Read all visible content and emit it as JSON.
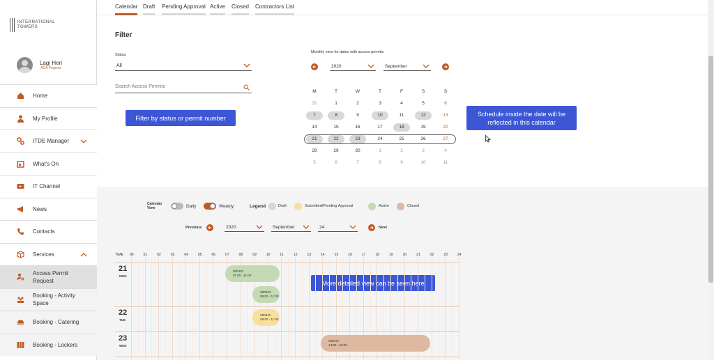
{
  "tabs": [
    {
      "label": "Calendar",
      "active": true
    },
    {
      "label": "Draft",
      "active": false
    },
    {
      "label": "Pending Approval",
      "active": false
    },
    {
      "label": "Active",
      "active": false
    },
    {
      "label": "Closed",
      "active": false
    },
    {
      "label": "Contractors List",
      "active": false
    }
  ],
  "logo": {
    "line1": "INTERNATIONAL",
    "line2": "TOWERS"
  },
  "profile": {
    "name": "Lagi Heri",
    "role": "ACA Projects"
  },
  "menu": [
    {
      "label": "Home",
      "icon": "home-icon"
    },
    {
      "label": "My Profile",
      "icon": "user-icon"
    },
    {
      "label": "ITDE Manager",
      "icon": "gears-icon"
    },
    {
      "label": "What's On",
      "icon": "calendar-icon"
    },
    {
      "label": "IT Channel",
      "icon": "video-icon"
    },
    {
      "label": "News",
      "icon": "megaphone-icon"
    },
    {
      "label": "Contacts",
      "icon": "phone-icon"
    },
    {
      "label": "Services",
      "icon": "box-icon"
    },
    {
      "label": "Access Permit Request",
      "icon": "key-person-icon"
    },
    {
      "label": "Booking - Activity Space",
      "icon": "people-icon"
    },
    {
      "label": "Booking - Catering",
      "icon": "food-icon"
    },
    {
      "label": "Booking - Lockers",
      "icon": "lockers-icon"
    }
  ],
  "filter": {
    "title": "Filter",
    "status_label": "Status",
    "status_value": "All",
    "search_placeholder": "Search Access Permits"
  },
  "monthly": {
    "label": "Monthly view for dates with access permits",
    "year": "2020",
    "month": "September",
    "weekdays": [
      "M",
      "T",
      "W",
      "T",
      "F",
      "S",
      "S"
    ],
    "weeks": [
      [
        "31",
        "1",
        "2",
        "3",
        "4",
        "5",
        "6"
      ],
      [
        "7",
        "8",
        "9",
        "10",
        "11",
        "12",
        "13"
      ],
      [
        "14",
        "15",
        "16",
        "17",
        "18",
        "19",
        "20"
      ],
      [
        "21",
        "22",
        "23",
        "24",
        "25",
        "26",
        "27"
      ],
      [
        "28",
        "29",
        "30",
        "1",
        "2",
        "3",
        "4"
      ],
      [
        "5",
        "6",
        "7",
        "8",
        "9",
        "10",
        "11"
      ]
    ]
  },
  "tooltips": {
    "filter": "Filter by status or permit number",
    "schedule": "Schedule inside the date will be reflected in this calendar",
    "detailed": "More detailed view can be seen here"
  },
  "weekly": {
    "calendar_view_label": "Calendar View",
    "daily_label": "Daily",
    "weekly_label": "Weekly",
    "legend_label": "Legend",
    "legend": [
      {
        "label": "Draft",
        "color": "#c9dbe9"
      },
      {
        "label": "Submitted/Pending Approval",
        "color": "#f8df9a"
      },
      {
        "label": "Active",
        "color": "#c3dab2"
      },
      {
        "label": "Closed",
        "color": "#dcb9a0"
      }
    ],
    "previous_label": "Previous",
    "next_label": "Next",
    "year": "2020",
    "month": "September",
    "day": "24",
    "time_label": "TIME",
    "hours": [
      "00",
      "01",
      "02",
      "03",
      "04",
      "05",
      "06",
      "07",
      "08",
      "09",
      "10",
      "11",
      "12",
      "13",
      "14",
      "15",
      "16",
      "17",
      "18",
      "19",
      "20",
      "21",
      "22",
      "23",
      "24"
    ],
    "days": [
      {
        "num": "21",
        "name": "MON"
      },
      {
        "num": "22",
        "name": "TUE"
      },
      {
        "num": "23",
        "name": "WED"
      }
    ],
    "events": [
      {
        "id": "000332",
        "time": "07:00 - 11:00",
        "day": 0,
        "lane": 0,
        "start": 7,
        "end": 11,
        "color": "#c3dab2"
      },
      {
        "id": "000333",
        "time": "09:00 - 11:00",
        "day": 0,
        "lane": 1,
        "start": 9,
        "end": 11,
        "color": "#c3dab2"
      },
      {
        "id": "000331",
        "time": "09:00 - 11:00",
        "day": 1,
        "lane": 0,
        "start": 9,
        "end": 11,
        "color": "#f8df9a"
      },
      {
        "id": "000371",
        "time": "14:00 - 22:00",
        "day": 2,
        "lane": 0,
        "start": 14,
        "end": 22,
        "color": "#dcb9a0"
      }
    ]
  },
  "colors": {
    "accent": "#c05a25",
    "tooltip": "#3c56d6"
  }
}
